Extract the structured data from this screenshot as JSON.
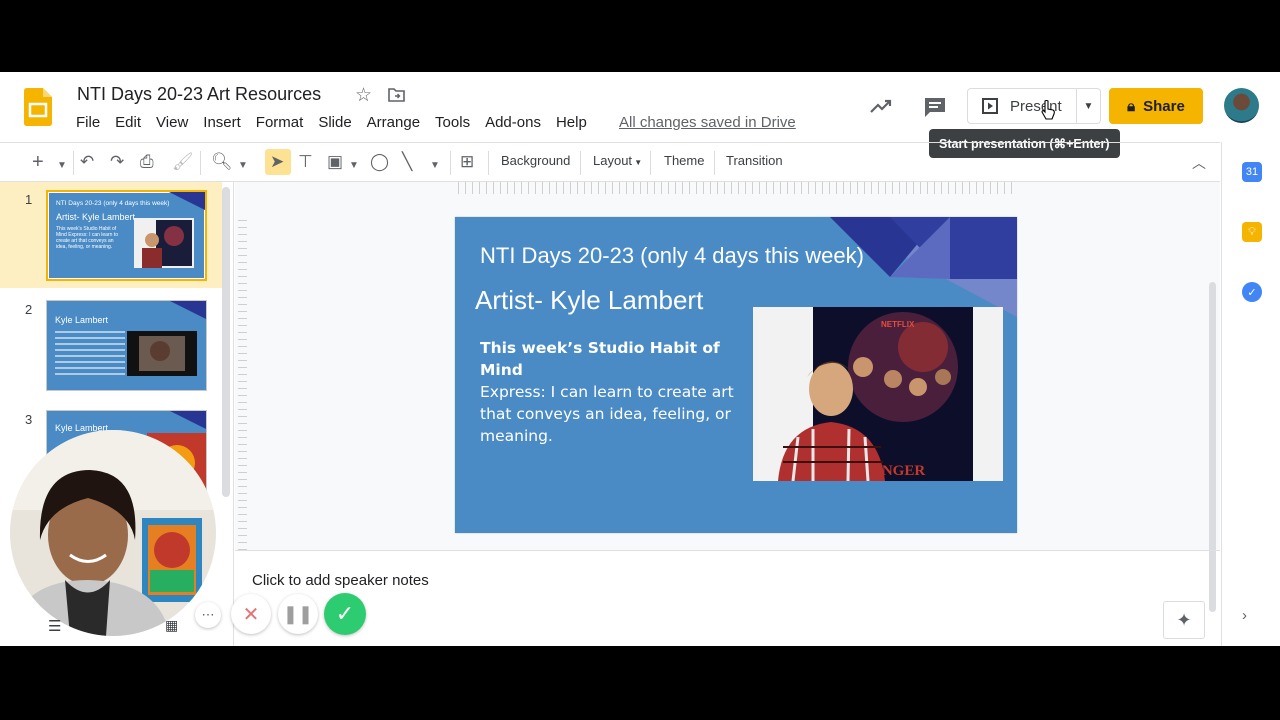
{
  "header": {
    "doc_title": "NTI Days 20-23 Art Resources",
    "menu": [
      "File",
      "Edit",
      "View",
      "Insert",
      "Format",
      "Slide",
      "Arrange",
      "Tools",
      "Add-ons",
      "Help"
    ],
    "save_status": "All changes saved in Drive",
    "present_label": "Present",
    "share_label": "Share",
    "present_tooltip": "Start presentation (⌘+Enter)",
    "brand_color": "#f4b400"
  },
  "toolbar": {
    "background_label": "Background",
    "layout_label": "Layout",
    "theme_label": "Theme",
    "transition_label": "Transition"
  },
  "filmstrip": {
    "slides": [
      {
        "num": "1",
        "title": "NTI Days 20-23 (only 4 days this week)",
        "heading": "Artist- Kyle Lambert",
        "body": "This week's Studio Habit of Mind Express: I can learn to create art that conveys an idea, feeling, or meaning."
      },
      {
        "num": "2",
        "heading": "Kyle Lambert"
      },
      {
        "num": "3",
        "heading": "Kyle Lambert"
      }
    ]
  },
  "slide": {
    "title": "NTI Days 20-23 (only 4 days this week)",
    "artist": "Artist- Kyle Lambert",
    "habit_heading": "This week’s Studio Habit of Mind",
    "habit_body": "Express: I can learn to create art that conveys an idea, feeling, or meaning.",
    "poster_brand": "NETFLIX",
    "poster_text": "ANGER",
    "background_color": "#4a8bc6"
  },
  "notes": {
    "placeholder": "Click to add speaker notes"
  },
  "side_panel": {
    "calendar_day": "31"
  }
}
